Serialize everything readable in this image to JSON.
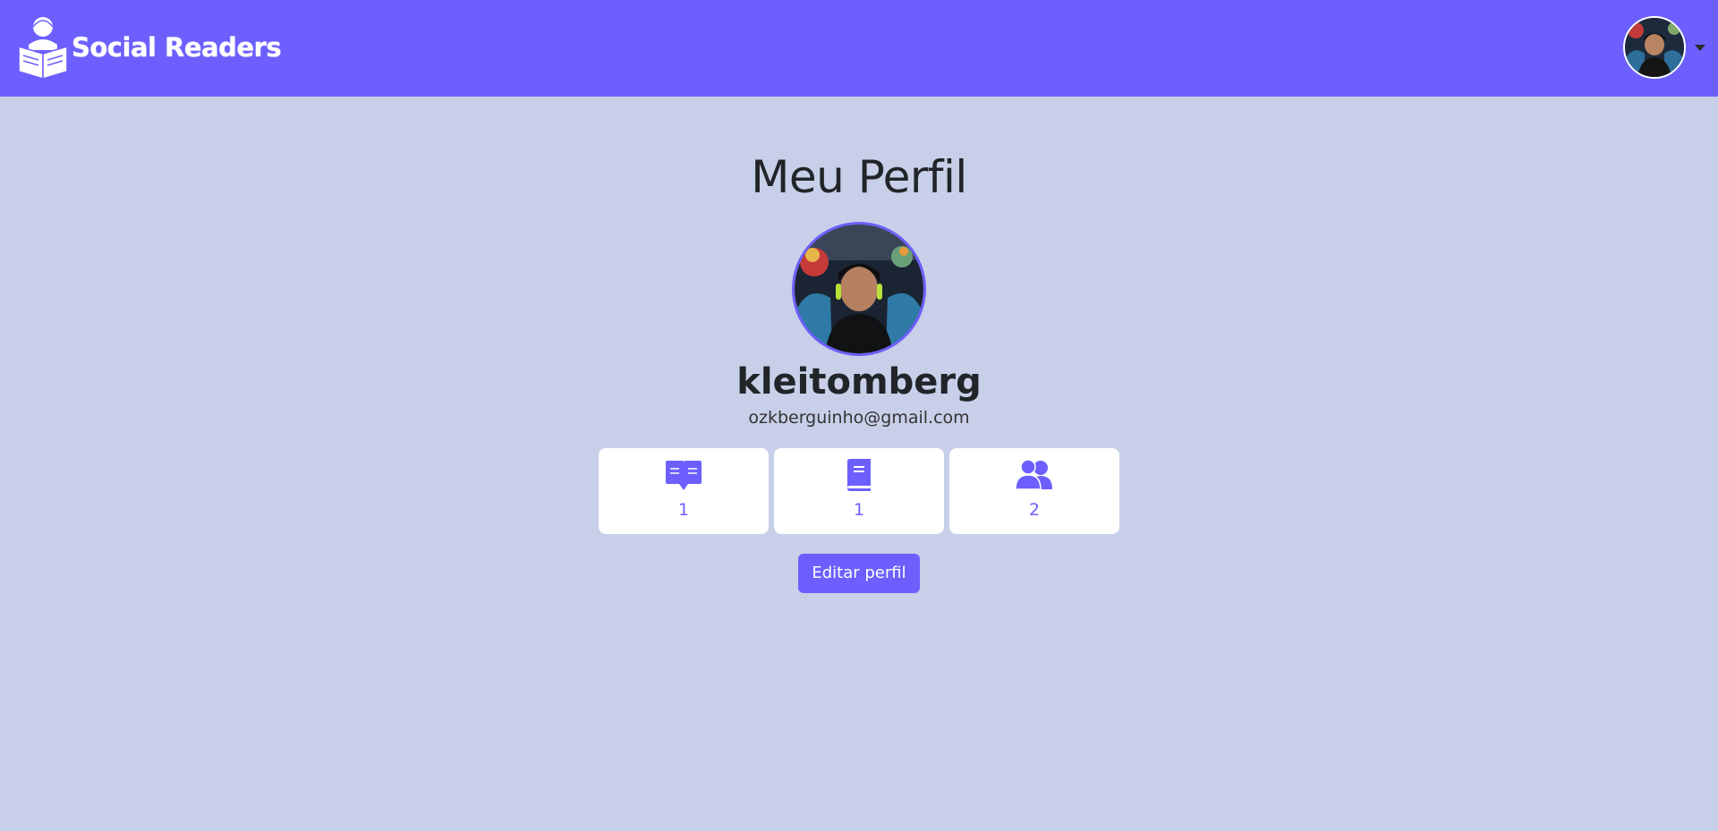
{
  "navbar": {
    "brand": "Social Readers",
    "logo_icon": "reader-book-logo",
    "avatar_icon": "user-avatar",
    "dropdown_icon": "caret-down-icon",
    "background": "#6c5ffe"
  },
  "profile": {
    "page_title": "Meu Perfil",
    "username": "kleitomberg",
    "email": "ozkberguinho@gmail.com",
    "avatar_icon": "profile-photo"
  },
  "stats": [
    {
      "icon": "open-book-icon",
      "value": "1"
    },
    {
      "icon": "book-icon",
      "value": "1"
    },
    {
      "icon": "users-icon",
      "value": "2"
    }
  ],
  "actions": {
    "edit_label": "Editar perfil"
  },
  "colors": {
    "accent": "#6c5ffe",
    "page_background": "#c8cfe8",
    "card_background": "#ffffff"
  }
}
